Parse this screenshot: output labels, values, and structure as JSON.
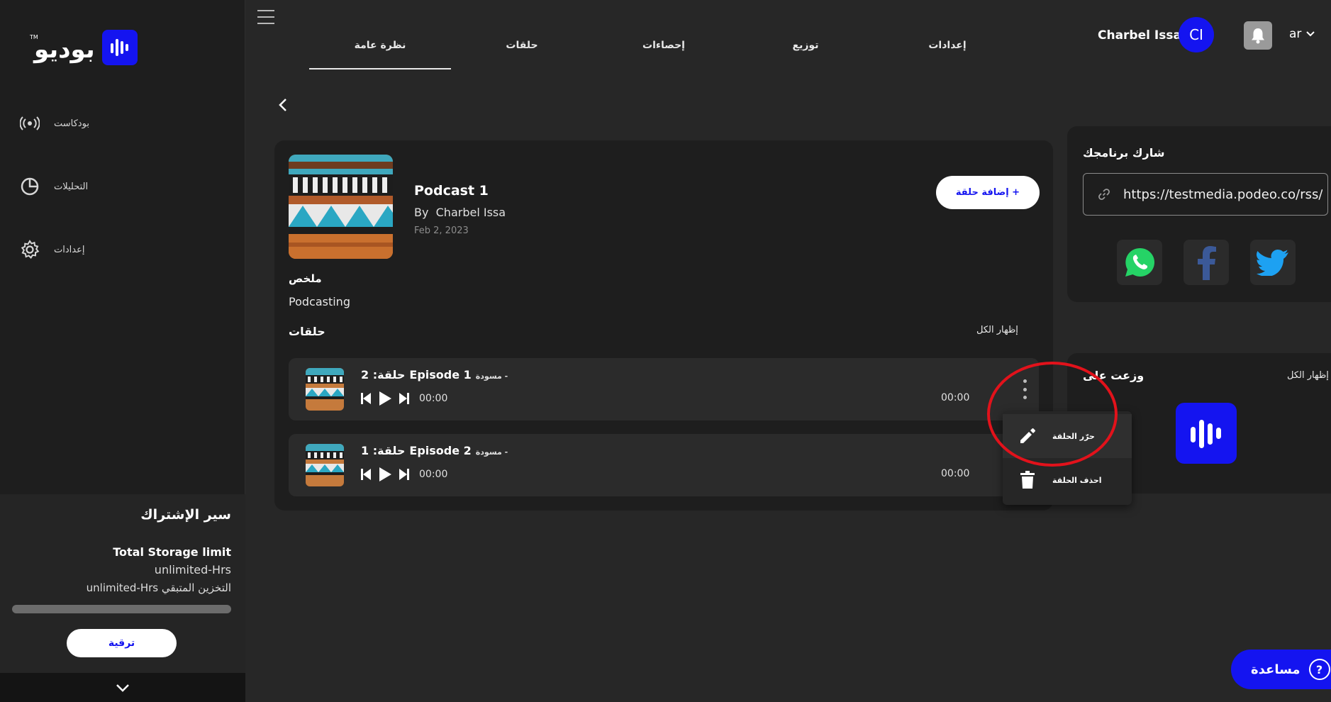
{
  "brand": {
    "logo_text": "بوديو",
    "logo_tm": "TM",
    "accent_color": "#1414f0"
  },
  "sidebar": {
    "items": [
      {
        "label": "بودكاست",
        "icon": "broadcast-icon"
      },
      {
        "label": "التحليلات",
        "icon": "pie-chart-icon"
      },
      {
        "label": "إعدادات",
        "icon": "gear-icon"
      }
    ]
  },
  "subscription": {
    "title": "سير الإشتراك",
    "storage_label": "Total Storage limit",
    "storage_total": "unlimited-Hrs",
    "storage_remaining": "unlimited-Hrs التخزين المتبقي",
    "upgrade_label": "ترقية"
  },
  "header": {
    "tabs": [
      {
        "label": "نظرة عامة",
        "active": true
      },
      {
        "label": "حلقات"
      },
      {
        "label": "إحصاءات"
      },
      {
        "label": "توزيع"
      },
      {
        "label": "إعدادات"
      }
    ],
    "user_name": "Charbel Issa",
    "avatar_initials": "CI",
    "language": "ar"
  },
  "podcast": {
    "title": "Podcast 1",
    "by_prefix": "By",
    "author": "Charbel Issa",
    "date": "Feb 2, 2023",
    "add_episode_label": "إضافة حلقة +",
    "summary_title": "ملخص",
    "summary_text": "Podcasting",
    "episodes_title": "حلقات",
    "show_all_label": "إظهار الكل"
  },
  "episodes": [
    {
      "number_label": "2 :حلقة",
      "title": "Episode 1",
      "status": "مسودة -",
      "current_time": "00:00",
      "duration": "00:00"
    },
    {
      "number_label": "1 :حلقة",
      "title": "Episode 2",
      "status": "مسودة -",
      "current_time": "00:00",
      "duration": "00:00"
    }
  ],
  "episode_menu": {
    "items": [
      {
        "label": "حرّر الحلقة",
        "icon": "pencil-icon"
      },
      {
        "label": "احذف الحلقة",
        "icon": "trash-icon"
      }
    ]
  },
  "share": {
    "title": "شارك برنامجك",
    "rss_url": "https://testmedia.podeo.co/rss/",
    "socials": [
      "whatsapp-icon",
      "facebook-icon",
      "twitter-icon"
    ]
  },
  "distribution": {
    "title": "وزعت على",
    "show_all_label": "إظهار الكل"
  },
  "help": {
    "label": "مساعدة",
    "icon_glyph": "?"
  }
}
